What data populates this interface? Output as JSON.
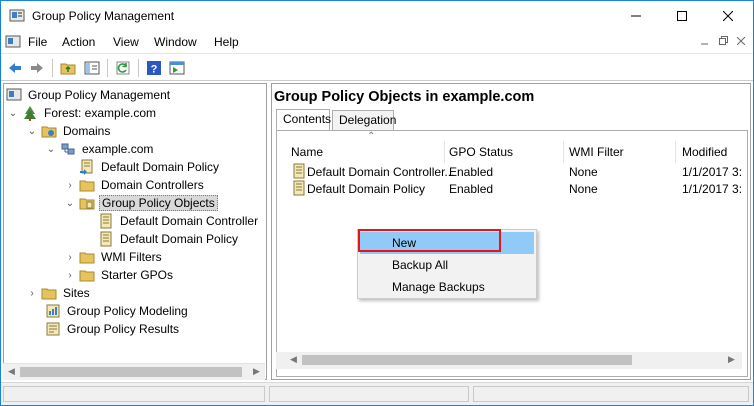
{
  "window": {
    "title": "Group Policy Management",
    "accent_color": "#1883d7"
  },
  "menubar": {
    "items": [
      "File",
      "Action",
      "View",
      "Window",
      "Help"
    ]
  },
  "toolbar": {
    "icons": [
      "back-arrow-icon",
      "forward-arrow-icon",
      "up-folder-icon",
      "show-hide-tree-icon",
      "refresh-icon",
      "help-icon",
      "properties-icon"
    ]
  },
  "tree": {
    "items": [
      {
        "label": "Group Policy Management",
        "icon": "gpm-icon",
        "chevron": ""
      },
      {
        "label": "Forest: example.com",
        "icon": "forest-icon",
        "chevron": "down"
      },
      {
        "label": "Domains",
        "icon": "folder-icon",
        "chevron": "down"
      },
      {
        "label": "example.com",
        "icon": "domain-icon",
        "chevron": "down"
      },
      {
        "label": "Default Domain Policy",
        "icon": "gpo-link-icon",
        "chevron": ""
      },
      {
        "label": "Domain Controllers",
        "icon": "folder-icon",
        "chevron": "right"
      },
      {
        "label": "Group Policy Objects",
        "icon": "folder-icon",
        "chevron": "down"
      },
      {
        "label": "Default Domain Controller",
        "icon": "gpo-icon",
        "chevron": ""
      },
      {
        "label": "Default Domain Policy",
        "icon": "gpo-icon",
        "chevron": ""
      },
      {
        "label": "WMI Filters",
        "icon": "folder-icon",
        "chevron": "right"
      },
      {
        "label": "Starter GPOs",
        "icon": "folder-icon",
        "chevron": "right"
      },
      {
        "label": "Sites",
        "icon": "folder-icon",
        "chevron": "right"
      },
      {
        "label": "Group Policy Modeling",
        "icon": "modeling-icon",
        "chevron": ""
      },
      {
        "label": "Group Policy Results",
        "icon": "results-icon",
        "chevron": ""
      }
    ],
    "selected_index": 6
  },
  "main": {
    "title": "Group Policy Objects in example.com",
    "tabs": [
      {
        "label": "Contents",
        "active": true
      },
      {
        "label": "Delegation",
        "active": false
      }
    ],
    "columns": [
      "Name",
      "GPO Status",
      "WMI Filter",
      "Modified"
    ],
    "rows": [
      {
        "name": "Default Domain Controller...",
        "status": "Enabled",
        "wmi": "None",
        "modified": "1/1/2017 3:"
      },
      {
        "name": "Default Domain Policy",
        "status": "Enabled",
        "wmi": "None",
        "modified": "1/1/2017 3:"
      }
    ]
  },
  "context_menu": {
    "items": [
      "New",
      "Backup All",
      "Manage Backups"
    ],
    "hover_color": "#91c9f7",
    "highlight_color": "#e8141a"
  }
}
